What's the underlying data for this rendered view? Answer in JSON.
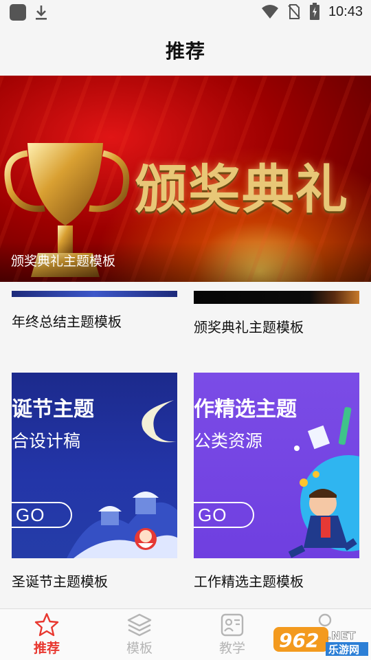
{
  "status_bar": {
    "time": "10:43",
    "left_icons": [
      "app-icon",
      "download-icon"
    ],
    "right_icons": [
      "wifi-icon",
      "no-sim-icon",
      "battery-charging-icon"
    ]
  },
  "header": {
    "title": "推荐"
  },
  "banner": {
    "art_text": "颁奖典礼",
    "caption": "颁奖典礼主题模板"
  },
  "cards": [
    {
      "title": "年终总结主题模板"
    },
    {
      "title": "颁奖典礼主题模板"
    },
    {
      "title": "圣诞节主题模板",
      "thumb_heading": "诞节主题",
      "thumb_sub": "合设计稿",
      "go": "GO"
    },
    {
      "title": "工作精选主题模板",
      "thumb_heading": "作精选主题",
      "thumb_sub": "公类资源",
      "go": "GO"
    }
  ],
  "bottom_nav": {
    "items": [
      {
        "label": "推荐",
        "icon": "star-icon",
        "active": true
      },
      {
        "label": "模板",
        "icon": "layers-icon",
        "active": false
      },
      {
        "label": "教学",
        "icon": "teaching-icon",
        "active": false
      },
      {
        "label": "",
        "icon": "profile-icon",
        "active": false
      }
    ]
  },
  "watermark": {
    "brand": "962",
    "domain": ".NET",
    "site_name": "乐游网"
  },
  "colors": {
    "accent": "#e8372f",
    "inactive": "#b5b5b5",
    "background": "#f5f5f5"
  }
}
